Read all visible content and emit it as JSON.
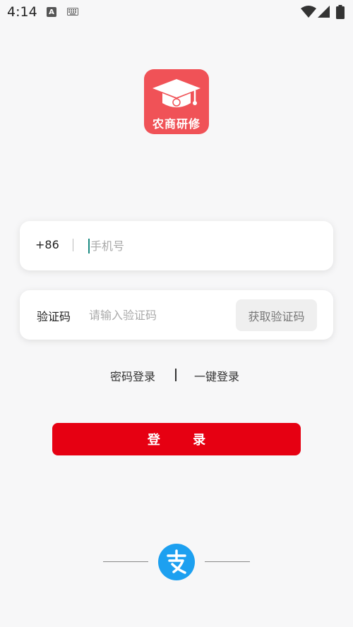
{
  "status_bar": {
    "time": "4:14",
    "icons": [
      "a-icon",
      "keyboard-icon",
      "wifi-icon",
      "signal-icon",
      "battery-icon"
    ]
  },
  "logo": {
    "text": "农商研修",
    "bg_color": "#f05257"
  },
  "phone_field": {
    "country_code": "+86",
    "placeholder": "手机号",
    "value": ""
  },
  "code_field": {
    "label": "验证码",
    "placeholder": "请输入验证码",
    "value": "",
    "get_code_label": "获取验证码"
  },
  "login_options": {
    "password_login": "密码登录",
    "one_click_login": "一键登录"
  },
  "login_button": {
    "label": "登 录",
    "color": "#e60012"
  },
  "alt_login": {
    "icon": "alipay-icon",
    "color": "#1da0f0"
  }
}
